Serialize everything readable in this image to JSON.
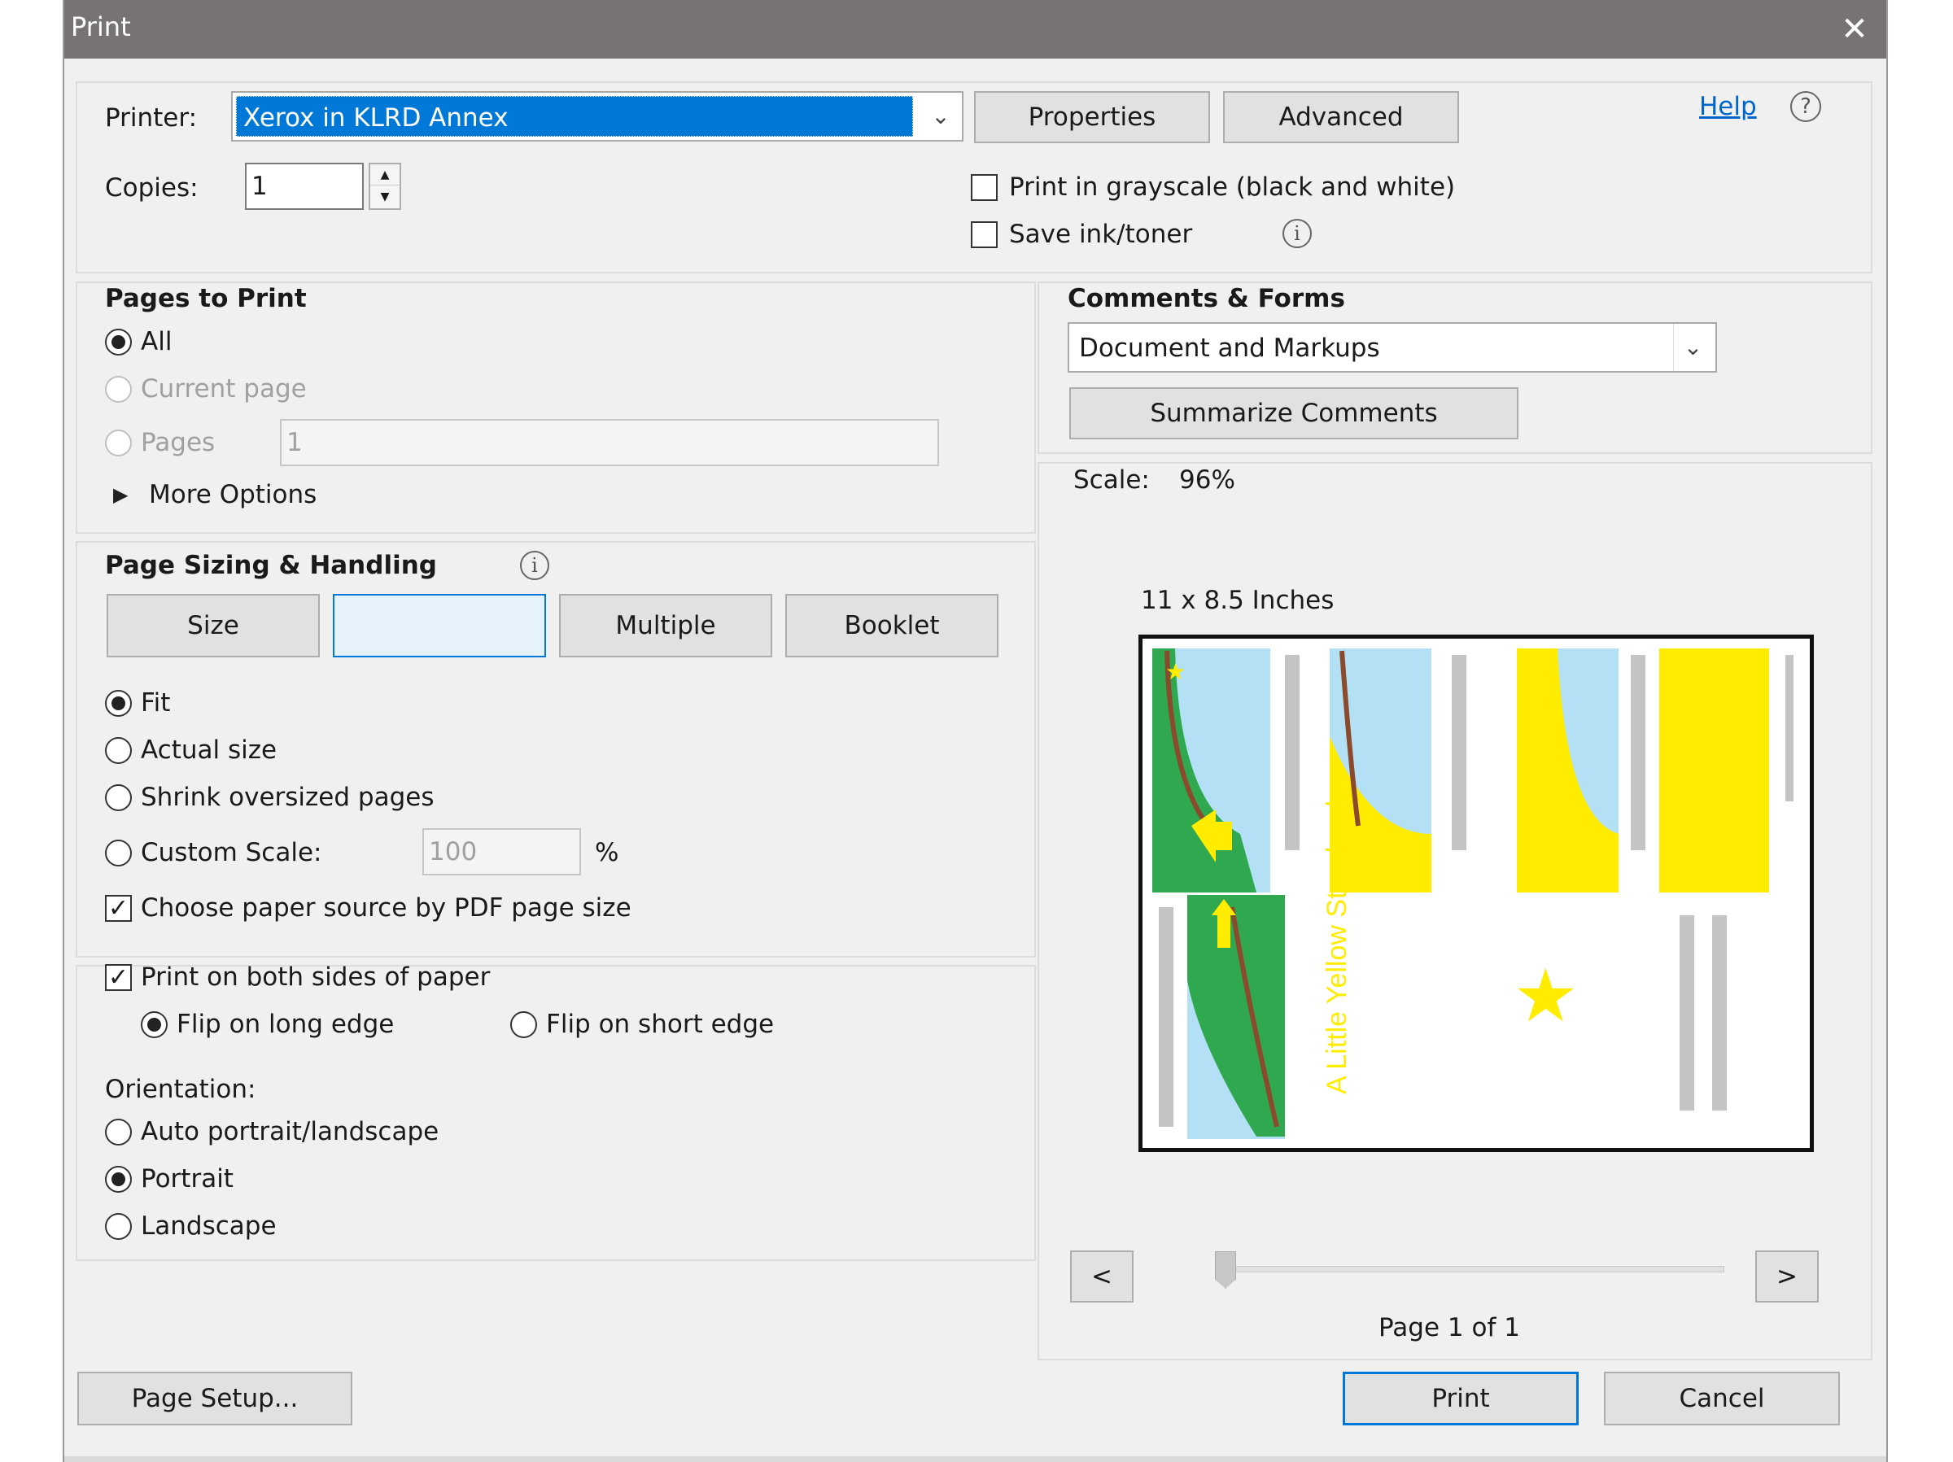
{
  "window": {
    "title": "Print",
    "close_glyph": "✕"
  },
  "printer": {
    "label": "Printer:",
    "selected": "Xerox in KLRD Annex",
    "properties_label": "Properties",
    "advanced_label": "Advanced",
    "help_label": "Help",
    "help_icon": "?"
  },
  "copies": {
    "label": "Copies:",
    "value": "1"
  },
  "options": {
    "grayscale_label": "Print in grayscale (black and white)",
    "grayscale_checked": false,
    "save_ink_label": "Save ink/toner",
    "save_ink_checked": false,
    "info_glyph": "i"
  },
  "pages_to_print": {
    "heading": "Pages to Print",
    "all_label": "All",
    "current_label": "Current page",
    "pages_label": "Pages",
    "pages_value": "1",
    "more_options_label": "More Options",
    "selected": "All"
  },
  "sizing": {
    "heading": "Page Sizing & Handling",
    "tabs": [
      "Size",
      "",
      "Multiple",
      "Booklet"
    ],
    "fit_label": "Fit",
    "actual_label": "Actual size",
    "shrink_label": "Shrink oversized pages",
    "custom_label": "Custom Scale:",
    "custom_value": "100",
    "percent_sign": "%",
    "paper_source_label": "Choose paper source by PDF page size",
    "paper_source_checked": true,
    "selected": "Fit"
  },
  "duplex": {
    "both_sides_label": "Print on both sides of paper",
    "both_sides_checked": true,
    "long_edge_label": "Flip on long edge",
    "short_edge_label": "Flip on short edge",
    "selected": "Flip on long edge"
  },
  "orientation": {
    "label": "Orientation:",
    "auto_label": "Auto portrait/landscape",
    "portrait_label": "Portrait",
    "landscape_label": "Landscape",
    "selected": "Portrait"
  },
  "comments": {
    "heading": "Comments & Forms",
    "selected": "Document and Markups",
    "summarize_label": "Summarize Comments"
  },
  "preview": {
    "scale_label": "Scale:",
    "scale_value": "96%",
    "paper_size": "11 x 8.5 Inches",
    "prev_label": "<",
    "next_label": ">",
    "page_indicator": "Page 1 of 1",
    "slider_position": 0,
    "thumb_title": "A Little Yellow Storybook"
  },
  "footer": {
    "page_setup_label": "Page Setup...",
    "print_label": "Print",
    "cancel_label": "Cancel"
  },
  "colors": {
    "accent": "#0078d7",
    "titlebar": "#777273",
    "dialog_bg": "#f0f0f0",
    "preview_yellow": "#ffec00",
    "preview_green": "#2fa84f",
    "preview_blue": "#b4e0f5"
  }
}
